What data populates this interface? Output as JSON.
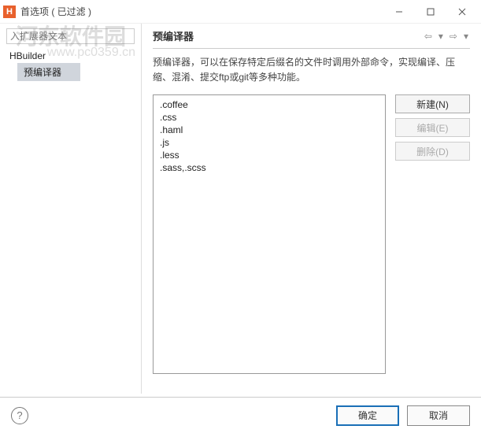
{
  "window": {
    "app_icon_letter": "H",
    "title": "首选项 ( 已过滤 )"
  },
  "sidebar": {
    "search_placeholder": "入扩展器文本",
    "tree": {
      "root": "HBuilder",
      "child": "预编译器"
    }
  },
  "main": {
    "heading": "预编译器",
    "description": "预编译器，可以在保存特定后缀名的文件时调用外部命令，实现编译、压缩、混淆、提交ftp或git等多种功能。",
    "list": [
      ".coffee",
      ".css",
      ".haml",
      ".js",
      ".less",
      ".sass,.scss"
    ],
    "buttons": {
      "new": "新建(N)",
      "edit": "编辑(E)",
      "delete": "删除(D)"
    }
  },
  "footer": {
    "ok": "确定",
    "cancel": "取消"
  },
  "watermarks": {
    "top": "河东软件园",
    "sub": "www.pc0359.cn",
    "center": ""
  }
}
